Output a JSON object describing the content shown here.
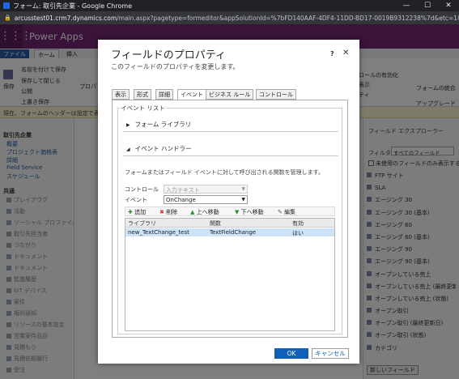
{
  "window": {
    "title": "フォーム: 取引先企業 - Google Chrome",
    "minimize": "—",
    "maximize": "☐",
    "close": "✕"
  },
  "urlbar": {
    "host": "arcusstest01.crm7.dynamics.com",
    "path": "/main.aspx?pagetype=formeditor&appSolutionId=%7bFD140AAF-4DF4-11DD-BD17-0019B9312238%7d&etc=1&extraqs=fo..."
  },
  "header": {
    "brand": "Power Apps"
  },
  "ribbon": {
    "tabs": [
      "ファイル",
      "ホーム",
      "挿入"
    ],
    "save": "保存",
    "save_as": "名前を付けて保存",
    "save_close": "保存して閉じる",
    "publish": "公開",
    "upgrade_save": "上書き保存",
    "props": "プロパ",
    "role": "ロールの有効化",
    "display": "表示",
    "partial": "ティ",
    "merge": "フォームの統合",
    "upgrade": "アップグレード"
  },
  "infobar": {
    "text": "現在、フォームのヘッダーは設定で表示..."
  },
  "leftnav": {
    "entity": "取引先企業",
    "items": [
      "概要",
      "プロジェクト価格表",
      "詳細",
      "Field Service",
      "スケジュール"
    ],
    "common": "共通",
    "related": [
      "ブレイアウグ",
      "活動",
      "ソーシャル プロファイル",
      "取引先担当者",
      "つながり",
      "ドキュメント",
      "ドキュメント",
      "監査履歴",
      "IoT デバイス",
      "案件",
      "権利通知",
      "リソースの基本設定",
      "営業案件品目",
      "見積もり",
      "見積依頼履行",
      "受注"
    ]
  },
  "rightpanel": {
    "title": "フィールド エクスプローラー",
    "filter_label": "フィルター",
    "filter_value": "すべてのフィールド",
    "only_unused": "未使用のフィールドのみ表示する",
    "fields": [
      "FTP サイト",
      "SLA",
      "エージング 30",
      "エージング 30 (基本)",
      "エージング 60",
      "エージング 60 (基本)",
      "エージング 90",
      "エージング 90 (基本)",
      "オープンしている売上",
      "オープンしている売上 (最終更新日)",
      "オープンしている売上 (状態)",
      "オープン取引",
      "オープン取引 (最終更新日)",
      "オープン取引 (状態)",
      "カテゴリ"
    ],
    "new_field": "新しいフィールド"
  },
  "dialog": {
    "title": "フィールドのプロパティ",
    "subtitle": "このフィールドのプロパティを変更します。",
    "help": "?",
    "close": "✕",
    "tabs": [
      "表示",
      "形式",
      "詳細",
      "イベント",
      "ビジネス ルール",
      "コントロール"
    ],
    "active_tab": "イベント",
    "event_list": "イベント リスト",
    "form_library": "フォーム ライブラリ",
    "event_handler": "イベント ハンドラー",
    "description": "フォームまたはフィールド イベントに対して呼び出される関数を管理します。",
    "control_label": "コントロール",
    "control_value": "入力テキスト",
    "event_label": "イベント",
    "event_value": "OnChange",
    "toolbar": {
      "add": "追加",
      "delete": "削除",
      "up": "上へ移動",
      "down": "下へ移動",
      "edit": "編集"
    },
    "grid": {
      "headers": [
        "ライブラリ",
        "関数",
        "有効"
      ],
      "rows": [
        {
          "library": "new_TextChange_test",
          "function": "TextFieldChange",
          "enabled": "はい"
        }
      ]
    },
    "ok": "OK",
    "cancel": "キャンセル"
  }
}
